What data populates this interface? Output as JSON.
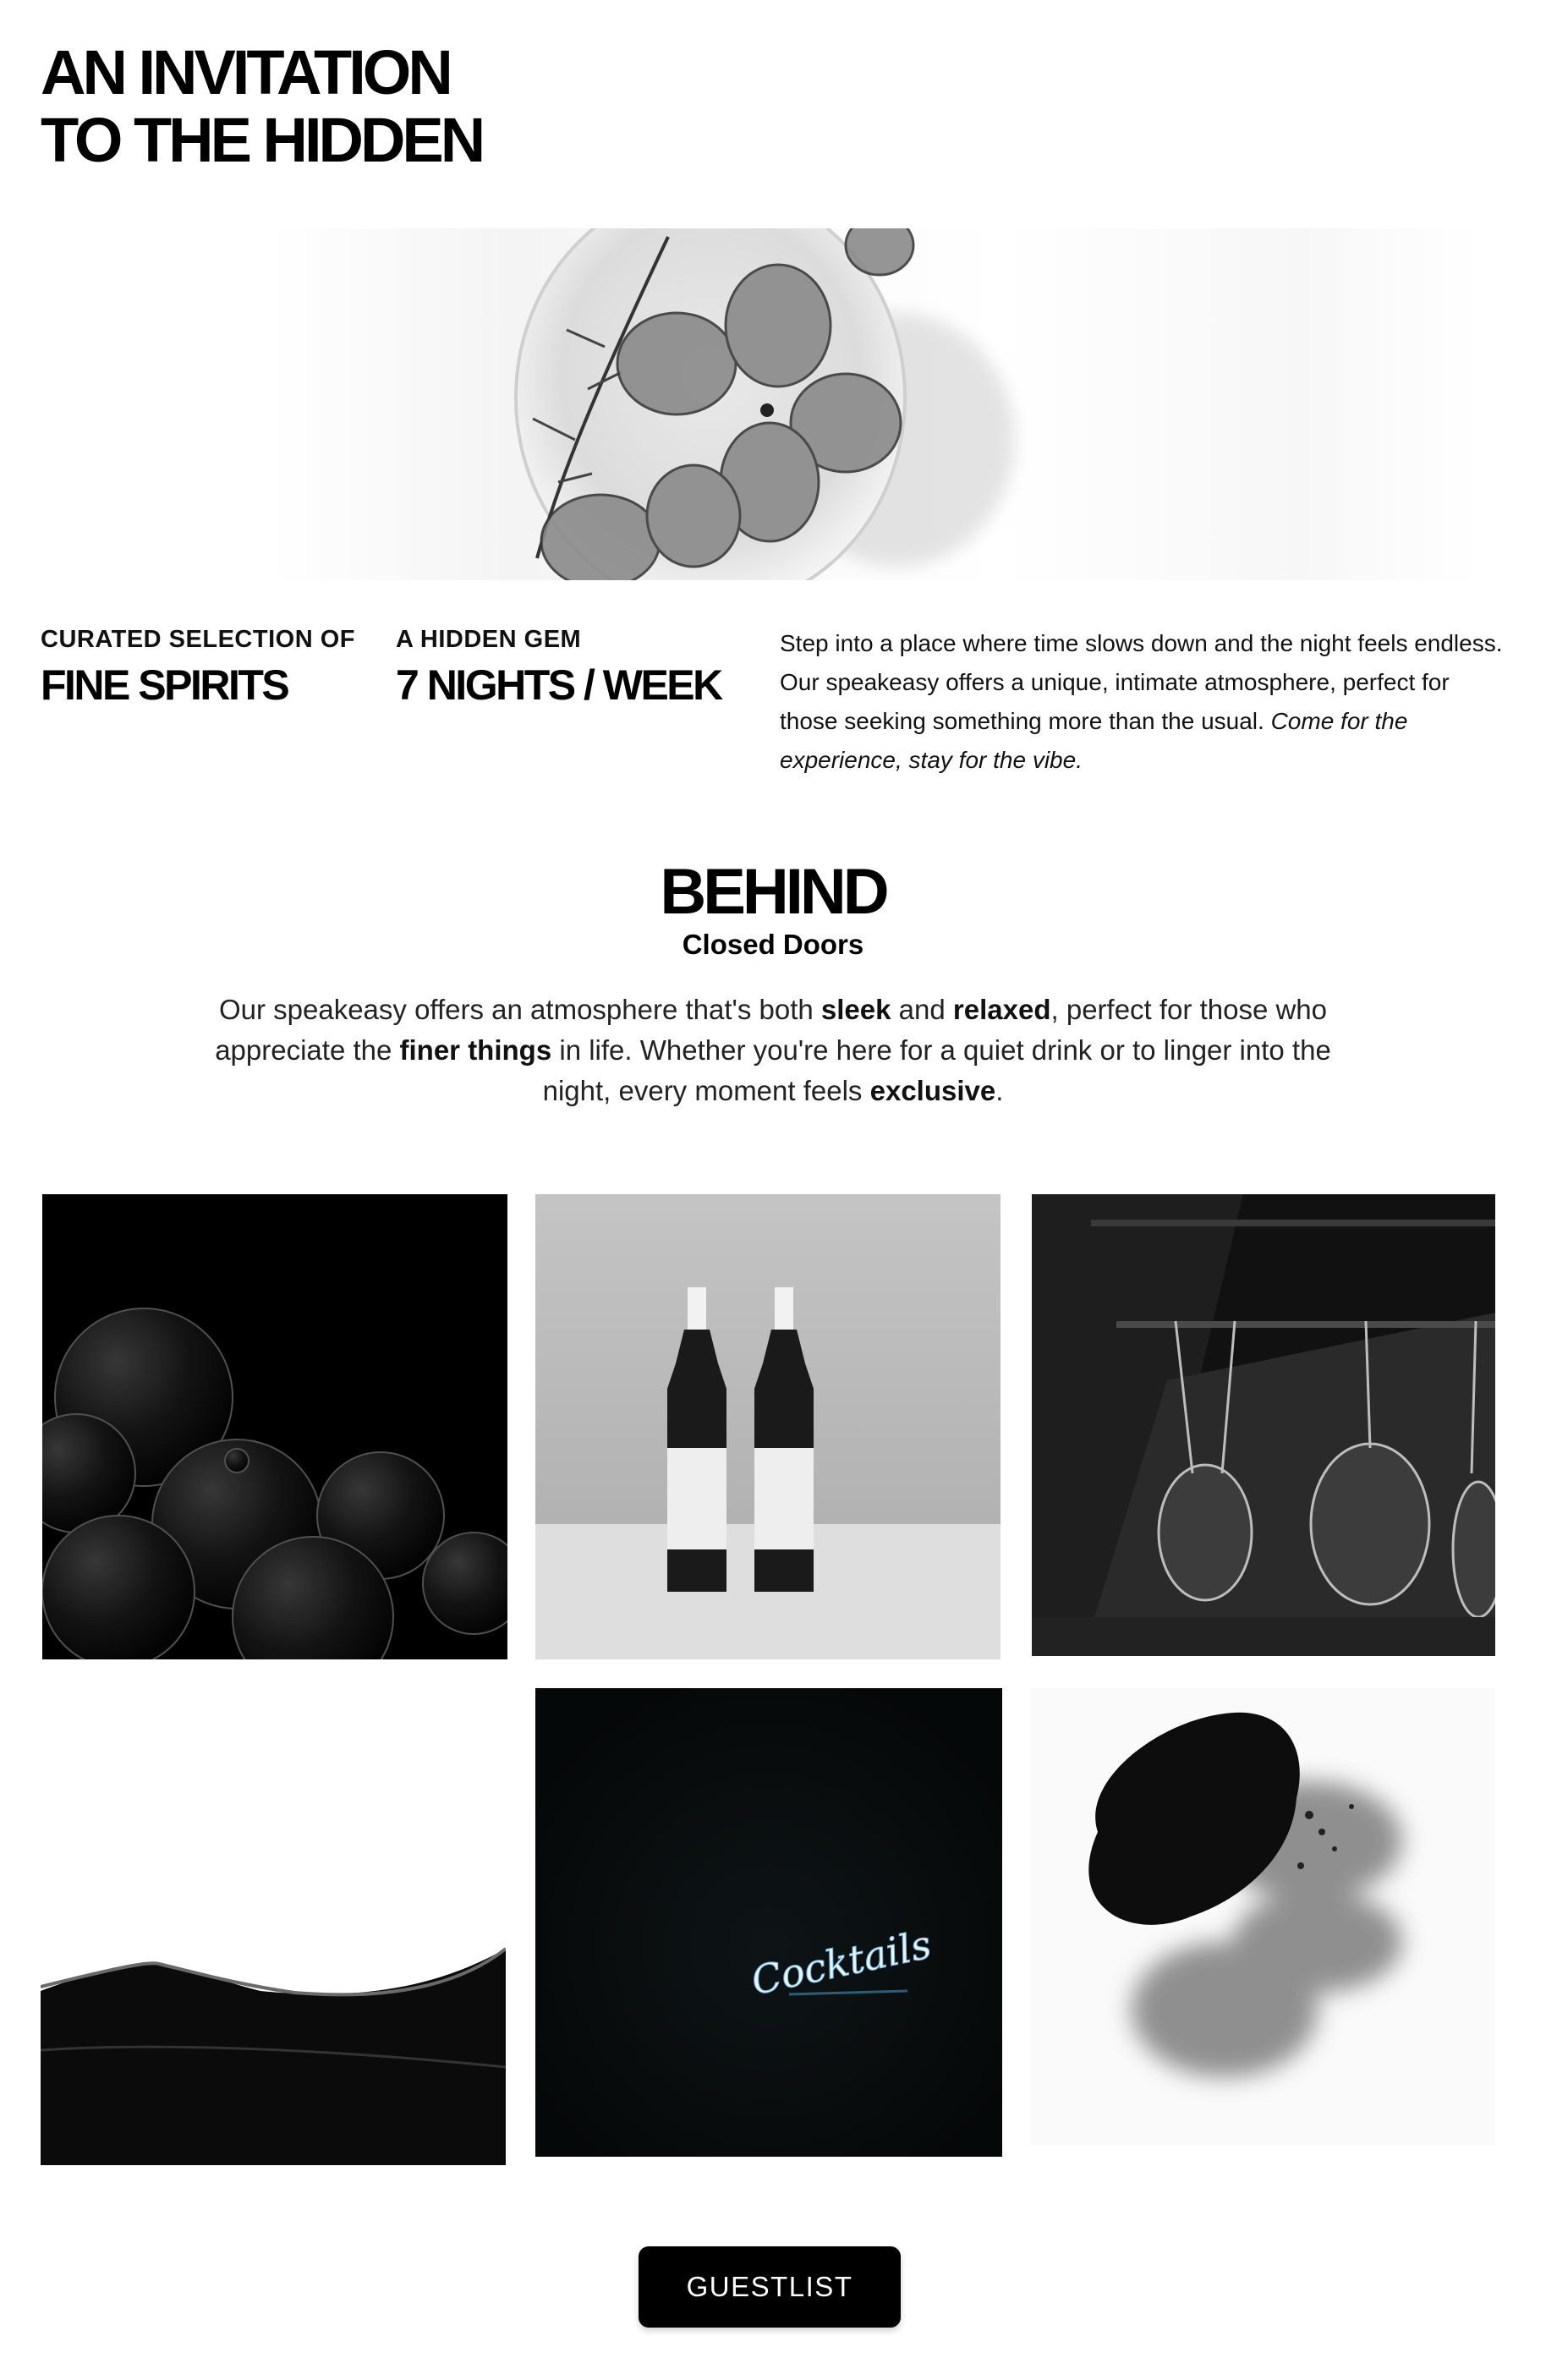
{
  "hero": {
    "title_line_1": "AN INVITATION",
    "title_line_2": "TO THE HIDDEN"
  },
  "stats": [
    {
      "label": "CURATED SELECTION OF",
      "value": "FINE SPIRITS"
    },
    {
      "label": "A HIDDEN GEM",
      "value": "7 NIGHTS / WEEK"
    }
  ],
  "intro": {
    "text": "Step into a place where time slows down and the night feels endless. Our speakeasy offers a unique, intimate atmosphere, perfect for those seeking something more than the usual.",
    "italic": "Come for the experience, stay for the vibe."
  },
  "behind": {
    "title": "BEHIND",
    "subtitle": "Closed Doors",
    "body_1": "Our speakeasy offers an atmosphere that's both ",
    "bold_1": "sleek",
    "body_2": " and ",
    "bold_2": "relaxed",
    "body_3": ", perfect for those who appreciate the ",
    "bold_3": "finer things",
    "body_4": " in life. Whether you're here for a quiet drink or to linger into the night, every moment feels ",
    "bold_4": "exclusive",
    "body_5": "."
  },
  "gallery": {
    "neon_sign_text": "Cocktails"
  },
  "cta": {
    "label": "GUESTLIST"
  }
}
